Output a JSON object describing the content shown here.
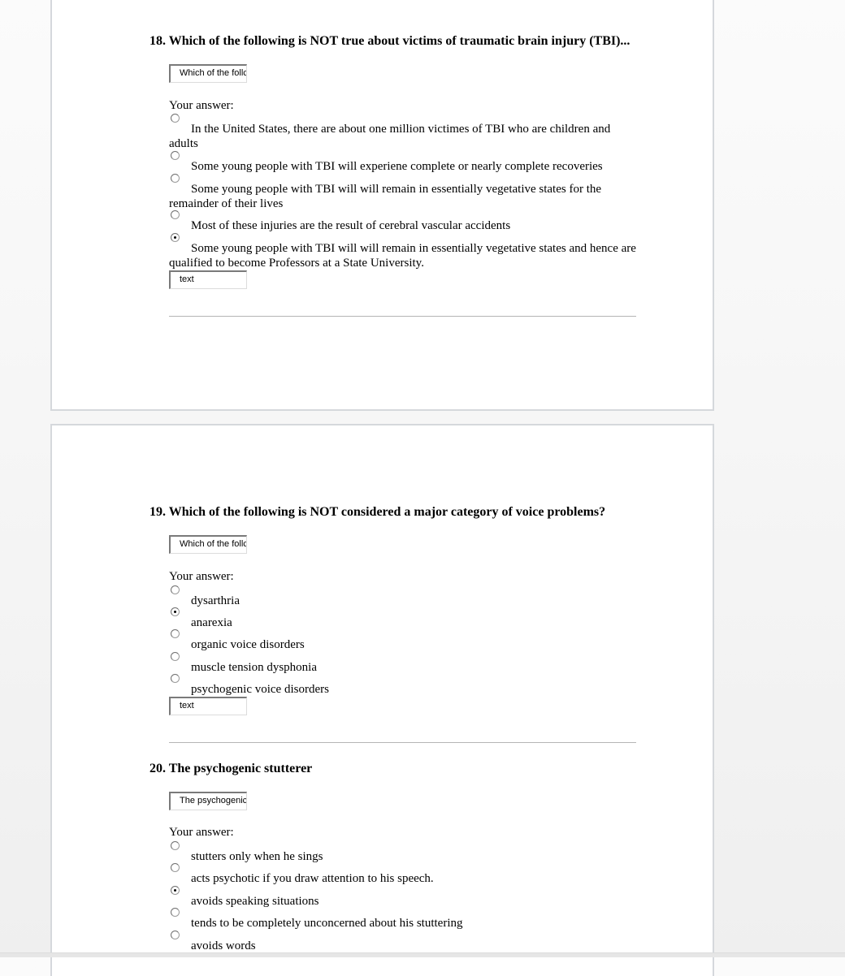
{
  "questions": [
    {
      "number": "18.",
      "title": "18. Which of the following is NOT true about victims of traumatic brain injury (TBI)...",
      "prompt_field": "Which of the follc",
      "your_answer_label": "Your answer:",
      "options": [
        {
          "text": "In the United States, there are about one million victimes of TBI who are children and adults",
          "selected": false
        },
        {
          "text": "Some young people with TBI will experiene complete or nearly complete recoveries",
          "selected": false
        },
        {
          "text": "Some young people with TBI will will remain in essentially vegetative states for the remainder of their lives",
          "selected": false
        },
        {
          "text": "Most of these injuries are the result of cerebral vascular accidents",
          "selected": false
        },
        {
          "text": "Some young people with TBI will will remain in essentially vegetative states and hence are qualified to become Professors at a State University.",
          "selected": true
        }
      ],
      "text_field": "text"
    },
    {
      "number": "19.",
      "title": "19. Which of the following is NOT considered a major category of voice problems?",
      "prompt_field": "Which of the follc",
      "your_answer_label": "Your answer:",
      "options": [
        {
          "text": "dysarthria",
          "selected": false
        },
        {
          "text": "anarexia",
          "selected": true
        },
        {
          "text": "organic voice disorders",
          "selected": false
        },
        {
          "text": "muscle tension dysphonia",
          "selected": false
        },
        {
          "text": "psychogenic voice disorders",
          "selected": false
        }
      ],
      "text_field": "text"
    },
    {
      "number": "20.",
      "title": "20. The psychogenic stutterer",
      "prompt_field": "The psychogenic",
      "your_answer_label": "Your answer:",
      "options": [
        {
          "text": "stutters only when he sings",
          "selected": false
        },
        {
          "text": "acts psychotic if you draw attention to his speech.",
          "selected": false
        },
        {
          "text": "avoids speaking situations",
          "selected": true
        },
        {
          "text": "tends to be completely unconcerned about his stuttering",
          "selected": false
        },
        {
          "text": "avoids words",
          "selected": false
        }
      ]
    }
  ]
}
